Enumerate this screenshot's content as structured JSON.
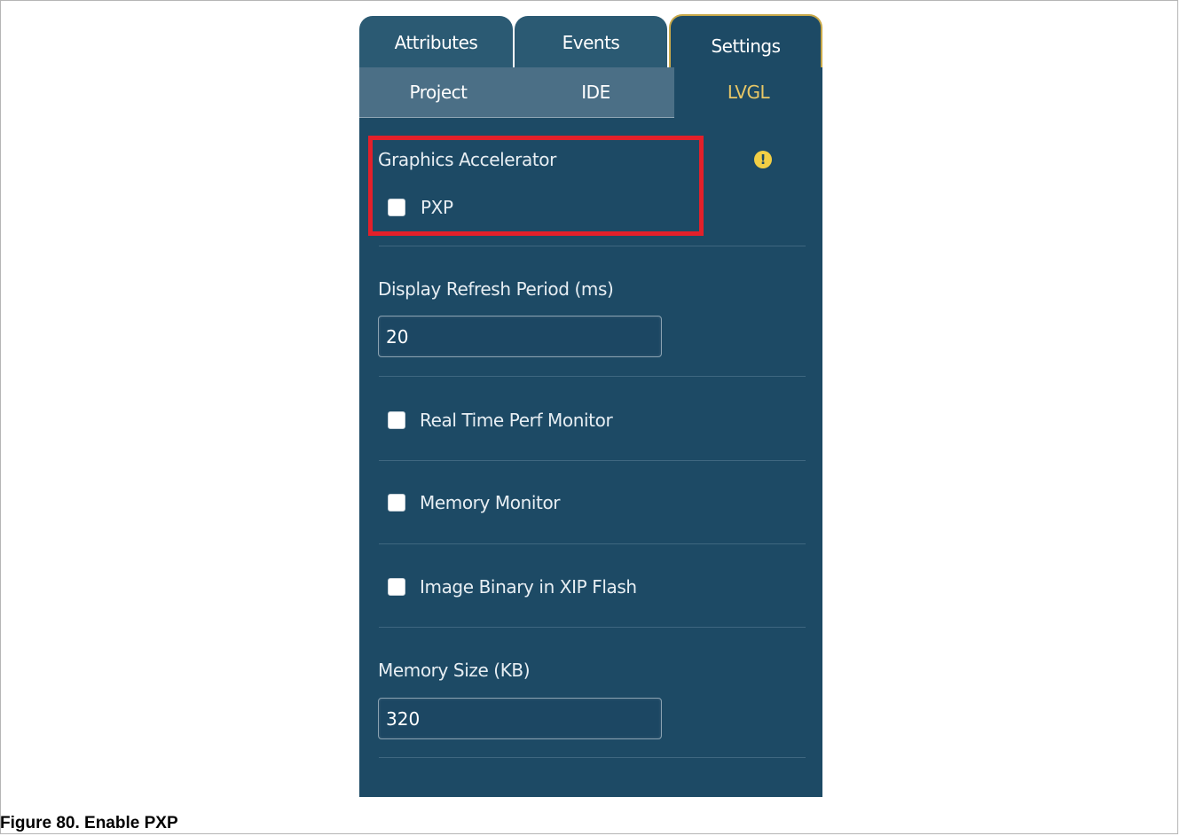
{
  "tabs": [
    {
      "label": "Attributes",
      "active": false
    },
    {
      "label": "Events",
      "active": false
    },
    {
      "label": "Settings",
      "active": true
    }
  ],
  "subtabs": [
    {
      "label": "Project",
      "active": false
    },
    {
      "label": "IDE",
      "active": false
    },
    {
      "label": "LVGL",
      "active": true
    }
  ],
  "graphics": {
    "title": "Graphics Accelerator",
    "pxp_label": "PXP",
    "pxp_checked": false,
    "warning_icon": "exclamation-icon",
    "warning_glyph": "!"
  },
  "display_refresh": {
    "label": "Display Refresh Period  (ms)",
    "value": "20"
  },
  "options": {
    "perf_monitor": "Real Time Perf Monitor",
    "memory_monitor": "Memory Monitor",
    "image_binary": "Image Binary in XIP Flash"
  },
  "memory_size": {
    "label": "Memory Size (KB)",
    "value": "320"
  },
  "caption": "Figure 80.  Enable PXP",
  "colors": {
    "panel": "#1d4a65",
    "active_accent": "#e8c766",
    "highlight": "#e3202a",
    "warning": "#f2cf45"
  }
}
